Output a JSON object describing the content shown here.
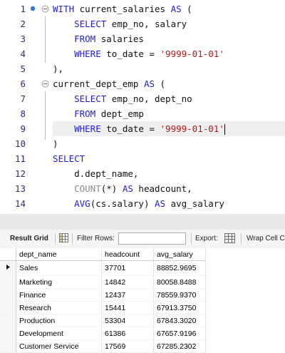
{
  "editor": {
    "lines": [
      {
        "num": "1",
        "segs": [
          {
            "t": "WITH ",
            "c": "kw"
          },
          {
            "t": "current_salaries ",
            "c": ""
          },
          {
            "t": "AS",
            "c": "kw"
          },
          {
            "t": " (",
            "c": ""
          }
        ]
      },
      {
        "num": "2",
        "segs": [
          {
            "t": "    SELECT ",
            "c": "kw"
          },
          {
            "t": "emp_no, salary",
            "c": ""
          }
        ]
      },
      {
        "num": "3",
        "segs": [
          {
            "t": "    FROM ",
            "c": "kw"
          },
          {
            "t": "salaries",
            "c": ""
          }
        ]
      },
      {
        "num": "4",
        "segs": [
          {
            "t": "    WHERE ",
            "c": "kw"
          },
          {
            "t": "to_date = ",
            "c": ""
          },
          {
            "t": "'9999-01-01'",
            "c": "str"
          }
        ]
      },
      {
        "num": "5",
        "segs": [
          {
            "t": "),",
            "c": ""
          }
        ]
      },
      {
        "num": "6",
        "segs": [
          {
            "t": "current_dept_emp ",
            "c": ""
          },
          {
            "t": "AS",
            "c": "kw"
          },
          {
            "t": " (",
            "c": ""
          }
        ]
      },
      {
        "num": "7",
        "segs": [
          {
            "t": "    SELECT ",
            "c": "kw"
          },
          {
            "t": "emp_no, dept_no",
            "c": ""
          }
        ]
      },
      {
        "num": "8",
        "segs": [
          {
            "t": "    FROM ",
            "c": "kw"
          },
          {
            "t": "dept_emp",
            "c": ""
          }
        ]
      },
      {
        "num": "9",
        "segs": [
          {
            "t": "    WHERE ",
            "c": "kw"
          },
          {
            "t": "to_date = ",
            "c": ""
          },
          {
            "t": "'9999-01-01'",
            "c": "str"
          }
        ]
      },
      {
        "num": "10",
        "segs": [
          {
            "t": ")",
            "c": ""
          }
        ]
      },
      {
        "num": "11",
        "segs": [
          {
            "t": "SELECT",
            "c": "kw"
          }
        ]
      },
      {
        "num": "12",
        "segs": [
          {
            "t": "    d.dept_name,",
            "c": ""
          }
        ]
      },
      {
        "num": "13",
        "segs": [
          {
            "t": "    COUNT",
            "c": "fn"
          },
          {
            "t": "(*) ",
            "c": ""
          },
          {
            "t": "AS",
            "c": "kw"
          },
          {
            "t": " headcount,",
            "c": ""
          }
        ]
      },
      {
        "num": "14",
        "segs": [
          {
            "t": "    AVG",
            "c": "kw"
          },
          {
            "t": "(cs.salary) ",
            "c": ""
          },
          {
            "t": "AS",
            "c": "kw"
          },
          {
            "t": " avg_salary",
            "c": ""
          }
        ]
      }
    ]
  },
  "toolbar": {
    "result_grid": "Result Grid",
    "filter_rows": "Filter Rows:",
    "filter_value": "",
    "export": "Export:",
    "wrap_cell": "Wrap Cell C"
  },
  "grid": {
    "columns": [
      "dept_name",
      "headcount",
      "avg_salary"
    ],
    "rows": [
      [
        "Sales",
        "37701",
        "88852.9695"
      ],
      [
        "Marketing",
        "14842",
        "80058.8488"
      ],
      [
        "Finance",
        "12437",
        "78559.9370"
      ],
      [
        "Research",
        "15441",
        "67913.3750"
      ],
      [
        "Production",
        "53304",
        "67843.3020"
      ],
      [
        "Development",
        "61386",
        "67657.9196"
      ],
      [
        "Customer Service",
        "17569",
        "67285.2302"
      ]
    ]
  },
  "colors": {
    "keyword": "#1f1fd6",
    "string": "#b31a1a",
    "function": "#8a8a8a",
    "line_number": "#2b2f7a",
    "breakpoint": "#2f7bd8"
  }
}
